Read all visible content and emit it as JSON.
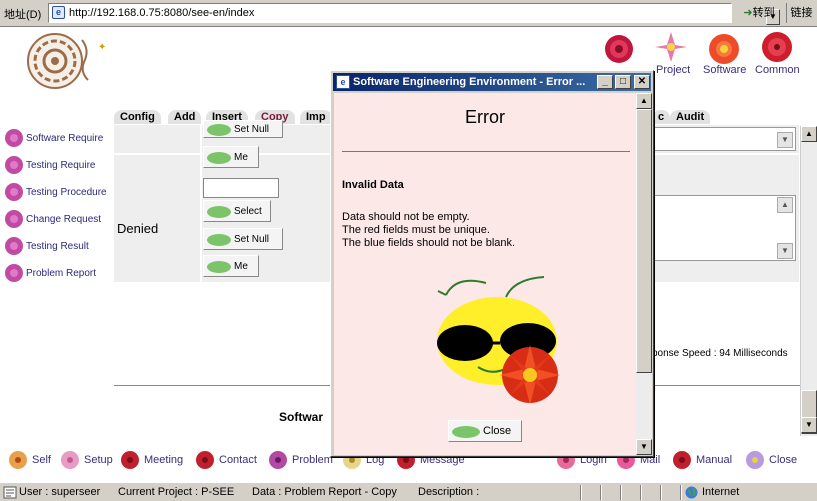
{
  "browser": {
    "address_label": "地址(D)",
    "url": "http://192.168.0.75:8080/see-en/index",
    "go_label": "转到",
    "links_label": "链接"
  },
  "top_links": [
    {
      "label": "Project",
      "color": "#d94f8a"
    },
    {
      "label": "Software",
      "color": "#e24a2b"
    },
    {
      "label": "Common",
      "color": "#d2212f"
    }
  ],
  "tabs": [
    "Config",
    "Add",
    "Insert",
    "Copy",
    "Imp",
    "c",
    "Audit"
  ],
  "left_nav": [
    "Software Require",
    "Testing Require",
    "Testing Procedure",
    "Change Request",
    "Testing Result",
    "Problem Report"
  ],
  "form": {
    "denied_label": "Denied",
    "buttons_row1": [
      "Set Null",
      "Me"
    ],
    "buttons_row2": [
      "Select",
      "Set Null",
      "Me"
    ]
  },
  "response_speed": "ponse Speed : 94 Milliseconds",
  "bottom_title": "Softwar",
  "bottom_nav": [
    "Self",
    "Setup",
    "Meeting",
    "Contact",
    "Problem",
    "Log",
    "Message",
    "Login",
    "Mail",
    "Manual",
    "Close"
  ],
  "status": {
    "user": "User : superseer",
    "project": "Current Project : P-SEE",
    "data": "Data : Problem Report - Copy",
    "description": "Description :",
    "zone": "Internet"
  },
  "popup": {
    "title": "Software Engineering Environment - Error ...",
    "heading": "Error",
    "subheading": "Invalid Data",
    "lines": [
      "Data should not be empty.",
      "The red fields must be unique.",
      "The blue fields should not be blank."
    ],
    "close_label": "Close"
  },
  "colors": {
    "popup_body": "#fde8e8",
    "title_bar": "#0a246a",
    "nav_text": "#2c2a7a"
  }
}
